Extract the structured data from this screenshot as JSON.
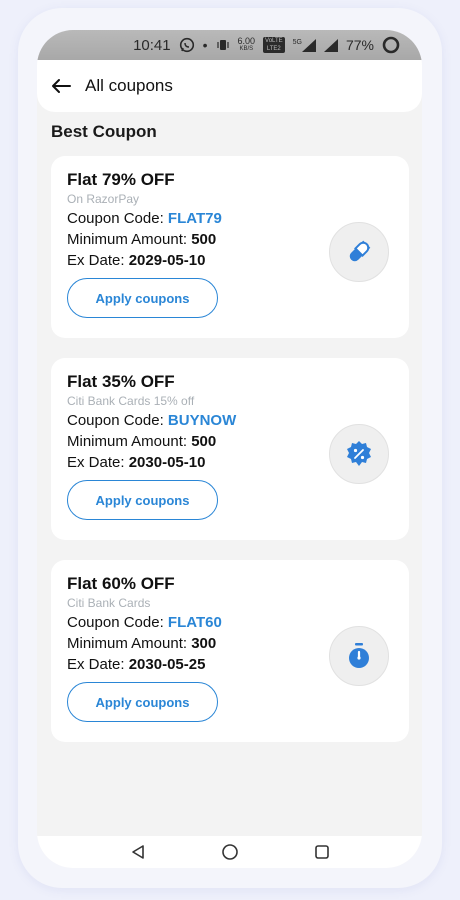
{
  "status_bar": {
    "time": "10:41",
    "speed_value": "6.00",
    "speed_unit": "KB/S",
    "volte_top": "VoLTE",
    "volte_bottom": "LTE2",
    "signal_label": "5G",
    "battery": "77%"
  },
  "header": {
    "title": "All coupons"
  },
  "section_title": "Best Coupon",
  "coupons": [
    {
      "title": "Flat 79% OFF",
      "subtitle": "On RazorPay",
      "code_label": "Coupon Code: ",
      "code": "FLAT79",
      "min_label": "Minimum Amount: ",
      "min_amount": "500",
      "date_label": "Ex Date: ",
      "date": "2029-05-10",
      "button": "Apply coupons",
      "icon": "pill-icon"
    },
    {
      "title": "Flat 35% OFF",
      "subtitle": "Citi Bank Cards 15% off",
      "code_label": "Coupon Code: ",
      "code": "BUYNOW",
      "min_label": "Minimum Amount: ",
      "min_amount": "500",
      "date_label": "Ex Date: ",
      "date": "2030-05-10",
      "button": "Apply coupons",
      "icon": "discount-badge-icon"
    },
    {
      "title": "Flat 60% OFF",
      "subtitle": "Citi Bank Cards",
      "code_label": "Coupon Code: ",
      "code": "FLAT60",
      "min_label": "Minimum Amount: ",
      "min_amount": "300",
      "date_label": "Ex Date: ",
      "date": "2030-05-25",
      "button": "Apply coupons",
      "icon": "stopwatch-icon"
    }
  ],
  "colors": {
    "accent": "#2a86d6",
    "icon_blue": "#2f7fd8",
    "background": "#f3f3f3",
    "card": "#ffffff",
    "subtitle": "#aab0b6"
  },
  "nav": {
    "icons": [
      "back-triangle-icon",
      "home-circle-icon",
      "recents-square-icon"
    ]
  }
}
